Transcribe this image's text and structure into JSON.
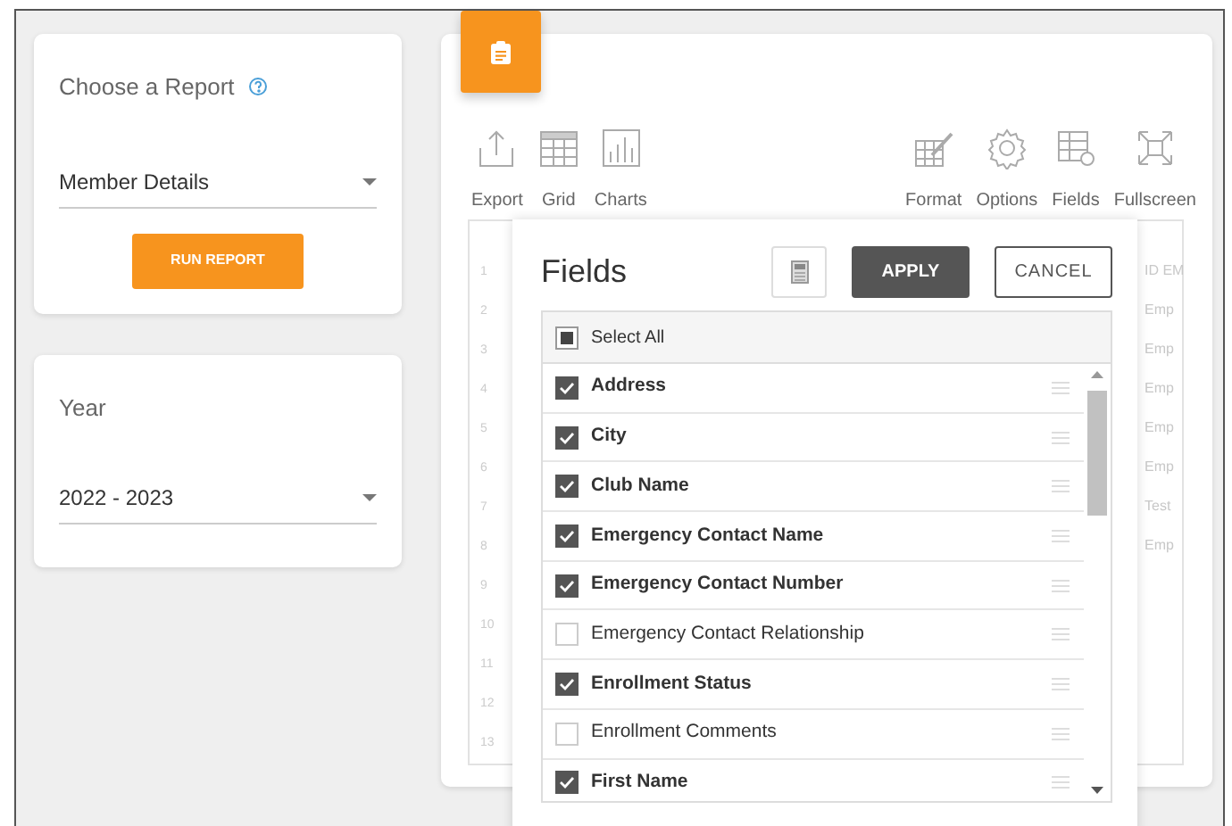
{
  "report_card": {
    "label": "Choose a Report",
    "report_select": "Member Details",
    "run_button": "RUN REPORT"
  },
  "year_card": {
    "label": "Year",
    "year_select": "2022 - 2023"
  },
  "toolbar": {
    "left": [
      {
        "label": "Export",
        "kind": "export"
      },
      {
        "label": "Grid",
        "kind": "grid"
      },
      {
        "label": "Charts",
        "kind": "charts"
      }
    ],
    "right": [
      {
        "label": "Format",
        "kind": "format"
      },
      {
        "label": "Options",
        "kind": "options"
      },
      {
        "label": "Fields",
        "kind": "fields"
      },
      {
        "label": "Fullscreen",
        "kind": "fullscreen"
      }
    ]
  },
  "grid": {
    "row_numbers": [
      "1",
      "2",
      "3",
      "4",
      "5",
      "6",
      "7",
      "8",
      "9",
      "10",
      "11",
      "12",
      "13"
    ],
    "last_column": [
      "ID EM",
      "Emp",
      "Emp",
      "Emp",
      "Emp",
      "Emp",
      "Test",
      "Emp"
    ]
  },
  "fields_dialog": {
    "title": "Fields",
    "apply_button": "APPLY",
    "cancel_button": "CANCEL",
    "select_all": {
      "label": "Select All",
      "indeterminate": true
    },
    "fields": [
      {
        "label": "Address",
        "checked": true
      },
      {
        "label": "City",
        "checked": true
      },
      {
        "label": "Club Name",
        "checked": true
      },
      {
        "label": "Emergency Contact Name",
        "checked": true
      },
      {
        "label": "Emergency Contact Number",
        "checked": true
      },
      {
        "label": "Emergency Contact Relationship",
        "checked": false
      },
      {
        "label": "Enrollment Status",
        "checked": true
      },
      {
        "label": "Enrollment Comments",
        "checked": false
      },
      {
        "label": "First Name",
        "checked": true
      }
    ]
  }
}
